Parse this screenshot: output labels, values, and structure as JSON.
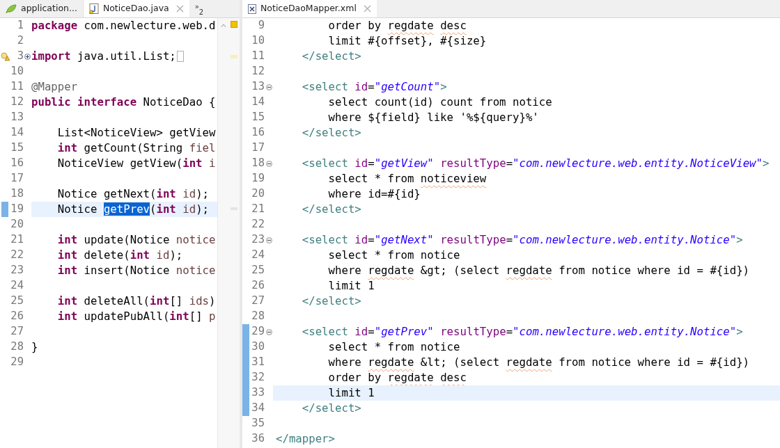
{
  "panes": [
    {
      "tabs": [
        {
          "label": "application...",
          "kind": "properties",
          "selected": false,
          "closable": false
        },
        {
          "label": "NoticeDao.java",
          "kind": "java",
          "selected": true,
          "closable": true
        }
      ],
      "overflow": {
        "glyph": "»",
        "count": "2"
      },
      "lines": [
        {
          "n": "1",
          "tokens": [
            {
              "kind": "keyword",
              "text": "package"
            },
            {
              "kind": "plain",
              "text": " com.newlecture.web.d"
            }
          ]
        },
        {
          "n": "2"
        },
        {
          "n": "3",
          "warning": true,
          "expanded": false,
          "folded_box": true,
          "tokens": [
            {
              "kind": "keyword",
              "text": "import"
            },
            {
              "kind": "plain",
              "text": " java.util.List;"
            }
          ]
        },
        {
          "n": "10"
        },
        {
          "n": "11",
          "tokens": [
            {
              "kind": "annotation",
              "text": "@Mapper"
            }
          ]
        },
        {
          "n": "12",
          "tokens": [
            {
              "kind": "keyword",
              "text": "public"
            },
            {
              "kind": "keyword",
              "text": " interface"
            },
            {
              "kind": "plain",
              "text": " NoticeDao {"
            }
          ]
        },
        {
          "n": "13"
        },
        {
          "n": "14",
          "tokens": [
            {
              "kind": "plain",
              "text": "    List<NoticeView> getView"
            }
          ]
        },
        {
          "n": "15",
          "tokens": [
            {
              "kind": "keyword",
              "text": "    int"
            },
            {
              "kind": "plain",
              "text": " getCount(String"
            },
            {
              "kind": "variable",
              "text": " fiel"
            }
          ]
        },
        {
          "n": "16",
          "tokens": [
            {
              "kind": "plain",
              "text": "    NoticeView getView("
            },
            {
              "kind": "keyword",
              "text": "int"
            },
            {
              "kind": "variable",
              "text": " i"
            }
          ]
        },
        {
          "n": "17"
        },
        {
          "n": "18",
          "tokens": [
            {
              "kind": "plain",
              "text": "    Notice getNext("
            },
            {
              "kind": "keyword",
              "text": "int"
            },
            {
              "kind": "variable",
              "text": " id"
            },
            {
              "kind": "plain",
              "text": ");"
            }
          ]
        },
        {
          "n": "19",
          "current": true,
          "changed": true,
          "tokens": [
            {
              "kind": "plain",
              "text": "    Notice "
            },
            {
              "kind": "selection",
              "text": "getPrev"
            },
            {
              "kind": "plain",
              "text": "("
            },
            {
              "kind": "keyword",
              "text": "int"
            },
            {
              "kind": "variable",
              "text": " id"
            },
            {
              "kind": "plain",
              "text": ");"
            }
          ]
        },
        {
          "n": "20"
        },
        {
          "n": "21",
          "tokens": [
            {
              "kind": "keyword",
              "text": "    int"
            },
            {
              "kind": "plain",
              "text": " update(Notice"
            },
            {
              "kind": "variable",
              "text": " notice"
            }
          ]
        },
        {
          "n": "22",
          "tokens": [
            {
              "kind": "keyword",
              "text": "    int"
            },
            {
              "kind": "plain",
              "text": " delete("
            },
            {
              "kind": "keyword",
              "text": "int"
            },
            {
              "kind": "variable",
              "text": " id"
            },
            {
              "kind": "plain",
              "text": ");"
            }
          ]
        },
        {
          "n": "23",
          "tokens": [
            {
              "kind": "keyword",
              "text": "    int"
            },
            {
              "kind": "plain",
              "text": " insert(Notice"
            },
            {
              "kind": "variable",
              "text": " notice"
            }
          ]
        },
        {
          "n": "24"
        },
        {
          "n": "25",
          "tokens": [
            {
              "kind": "keyword",
              "text": "    int"
            },
            {
              "kind": "plain",
              "text": " deleteAll("
            },
            {
              "kind": "keyword",
              "text": "int"
            },
            {
              "kind": "plain",
              "text": "[]"
            },
            {
              "kind": "variable",
              "text": " ids"
            },
            {
              "kind": "plain",
              "text": ")"
            }
          ]
        },
        {
          "n": "26",
          "tokens": [
            {
              "kind": "keyword",
              "text": "    int"
            },
            {
              "kind": "plain",
              "text": " updatePubAll("
            },
            {
              "kind": "keyword",
              "text": "int"
            },
            {
              "kind": "plain",
              "text": "[]"
            },
            {
              "kind": "variable",
              "text": " p"
            }
          ]
        },
        {
          "n": "27"
        },
        {
          "n": "28",
          "tokens": [
            {
              "kind": "plain",
              "text": "}"
            }
          ]
        },
        {
          "n": "29"
        }
      ]
    },
    {
      "tabs": [
        {
          "label": "NoticeDaoMapper.xml",
          "kind": "xml",
          "selected": true,
          "closable": true
        }
      ],
      "lines": [
        {
          "n": "9",
          "tokens": [
            {
              "kind": "plain",
              "text": "        order by"
            },
            {
              "kind": "misspelled",
              "text": " regdate"
            },
            {
              "kind": "misspelled",
              "text": " desc"
            }
          ]
        },
        {
          "n": "10",
          "tokens": [
            {
              "kind": "plain",
              "text": "        limit #{offset}, #{size}"
            }
          ]
        },
        {
          "n": "11",
          "tokens": [
            {
              "kind": "tag",
              "text": "    </select>"
            }
          ]
        },
        {
          "n": "12"
        },
        {
          "n": "13",
          "expanded": true,
          "tokens": [
            {
              "kind": "tag",
              "text": "    <select"
            },
            {
              "kind": "attribute",
              "text": " id"
            },
            {
              "kind": "plain",
              "text": "="
            },
            {
              "kind": "value",
              "text": "\"getCount\""
            },
            {
              "kind": "tag",
              "text": ">"
            }
          ]
        },
        {
          "n": "14",
          "tokens": [
            {
              "kind": "plain",
              "text": "        select count(id) count from notice"
            }
          ]
        },
        {
          "n": "15",
          "tokens": [
            {
              "kind": "plain",
              "text": "        where ${field} like '%${query}%'"
            }
          ]
        },
        {
          "n": "16",
          "tokens": [
            {
              "kind": "tag",
              "text": "    </select>"
            }
          ]
        },
        {
          "n": "17"
        },
        {
          "n": "18",
          "expanded": true,
          "tokens": [
            {
              "kind": "tag",
              "text": "    <select"
            },
            {
              "kind": "attribute",
              "text": " id"
            },
            {
              "kind": "plain",
              "text": "="
            },
            {
              "kind": "value",
              "text": "\"getView\""
            },
            {
              "kind": "attribute",
              "text": " resultType"
            },
            {
              "kind": "plain",
              "text": "="
            },
            {
              "kind": "value",
              "text": "\"com.newlecture.web.entity.NoticeView\""
            },
            {
              "kind": "tag",
              "text": ">"
            }
          ]
        },
        {
          "n": "19",
          "tokens": [
            {
              "kind": "plain",
              "text": "        select * from"
            },
            {
              "kind": "misspelled",
              "text": " noticeview"
            }
          ]
        },
        {
          "n": "20",
          "tokens": [
            {
              "kind": "plain",
              "text": "        where id=#{id}"
            }
          ]
        },
        {
          "n": "21",
          "tokens": [
            {
              "kind": "tag",
              "text": "    </select>"
            }
          ]
        },
        {
          "n": "22"
        },
        {
          "n": "23",
          "expanded": true,
          "tokens": [
            {
              "kind": "tag",
              "text": "    <select"
            },
            {
              "kind": "attribute",
              "text": " id"
            },
            {
              "kind": "plain",
              "text": "="
            },
            {
              "kind": "value",
              "text": "\"getNext\""
            },
            {
              "kind": "attribute",
              "text": " resultType"
            },
            {
              "kind": "plain",
              "text": "="
            },
            {
              "kind": "value",
              "text": "\"com.newlecture.web.entity.Notice\""
            },
            {
              "kind": "tag",
              "text": ">"
            }
          ]
        },
        {
          "n": "24",
          "tokens": [
            {
              "kind": "plain",
              "text": "        select * from notice"
            }
          ]
        },
        {
          "n": "25",
          "tokens": [
            {
              "kind": "plain",
              "text": "        where"
            },
            {
              "kind": "misspelled",
              "text": " regdate"
            },
            {
              "kind": "plain",
              "text": " &gt; (select"
            },
            {
              "kind": "misspelled",
              "text": " regdate"
            },
            {
              "kind": "plain",
              "text": " from notice where id = #{id})"
            }
          ]
        },
        {
          "n": "26",
          "tokens": [
            {
              "kind": "plain",
              "text": "        limit 1"
            }
          ]
        },
        {
          "n": "27",
          "tokens": [
            {
              "kind": "tag",
              "text": "    </select>"
            }
          ]
        },
        {
          "n": "28"
        },
        {
          "n": "29",
          "expanded": true,
          "changed": true,
          "tokens": [
            {
              "kind": "tag",
              "text": "    <select"
            },
            {
              "kind": "attribute",
              "text": " id"
            },
            {
              "kind": "plain",
              "text": "="
            },
            {
              "kind": "value",
              "text": "\"getPrev\""
            },
            {
              "kind": "attribute",
              "text": " resultType"
            },
            {
              "kind": "plain",
              "text": "="
            },
            {
              "kind": "value",
              "text": "\"com.newlecture.web.entity.Notice\""
            },
            {
              "kind": "tag",
              "text": ">"
            }
          ]
        },
        {
          "n": "30",
          "changed": true,
          "tokens": [
            {
              "kind": "plain",
              "text": "        select * from notice"
            }
          ]
        },
        {
          "n": "31",
          "changed": true,
          "tokens": [
            {
              "kind": "plain",
              "text": "        where"
            },
            {
              "kind": "misspelled",
              "text": " regdate"
            },
            {
              "kind": "plain",
              "text": " &lt; (select"
            },
            {
              "kind": "misspelled",
              "text": " regdate"
            },
            {
              "kind": "plain",
              "text": " from notice where id = #{id})"
            }
          ]
        },
        {
          "n": "32",
          "changed": true,
          "tokens": [
            {
              "kind": "plain",
              "text": "        order by"
            },
            {
              "kind": "misspelled",
              "text": " regdate"
            },
            {
              "kind": "misspelled",
              "text": " desc"
            }
          ]
        },
        {
          "n": "33",
          "changed": true,
          "current": true,
          "tokens": [
            {
              "kind": "plain",
              "text": "        limit 1"
            }
          ]
        },
        {
          "n": "34",
          "changed": true,
          "tokens": [
            {
              "kind": "tag",
              "text": "    </select>"
            }
          ]
        },
        {
          "n": "35"
        },
        {
          "n": "36",
          "tokens": [
            {
              "kind": "tag",
              "text": "</mapper>"
            }
          ]
        }
      ]
    }
  ]
}
